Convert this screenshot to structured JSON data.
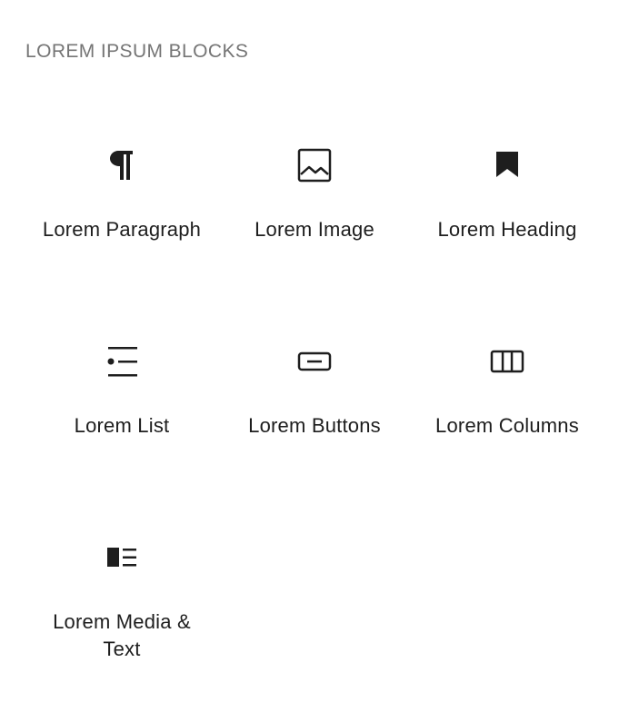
{
  "section": {
    "title": "LOREM IPSUM BLOCKS"
  },
  "blocks": [
    {
      "label": "Lorem Paragraph",
      "icon": "paragraph-icon"
    },
    {
      "label": "Lorem Image",
      "icon": "image-icon"
    },
    {
      "label": "Lorem Heading",
      "icon": "bookmark-icon"
    },
    {
      "label": "Lorem List",
      "icon": "list-icon"
    },
    {
      "label": "Lorem Buttons",
      "icon": "button-icon"
    },
    {
      "label": "Lorem Columns",
      "icon": "columns-icon"
    },
    {
      "label": "Lorem Media & Text",
      "icon": "media-text-icon"
    }
  ],
  "colors": {
    "title": "#757575",
    "text": "#1e1e1e",
    "icon": "#1e1e1e",
    "background": "#ffffff"
  }
}
